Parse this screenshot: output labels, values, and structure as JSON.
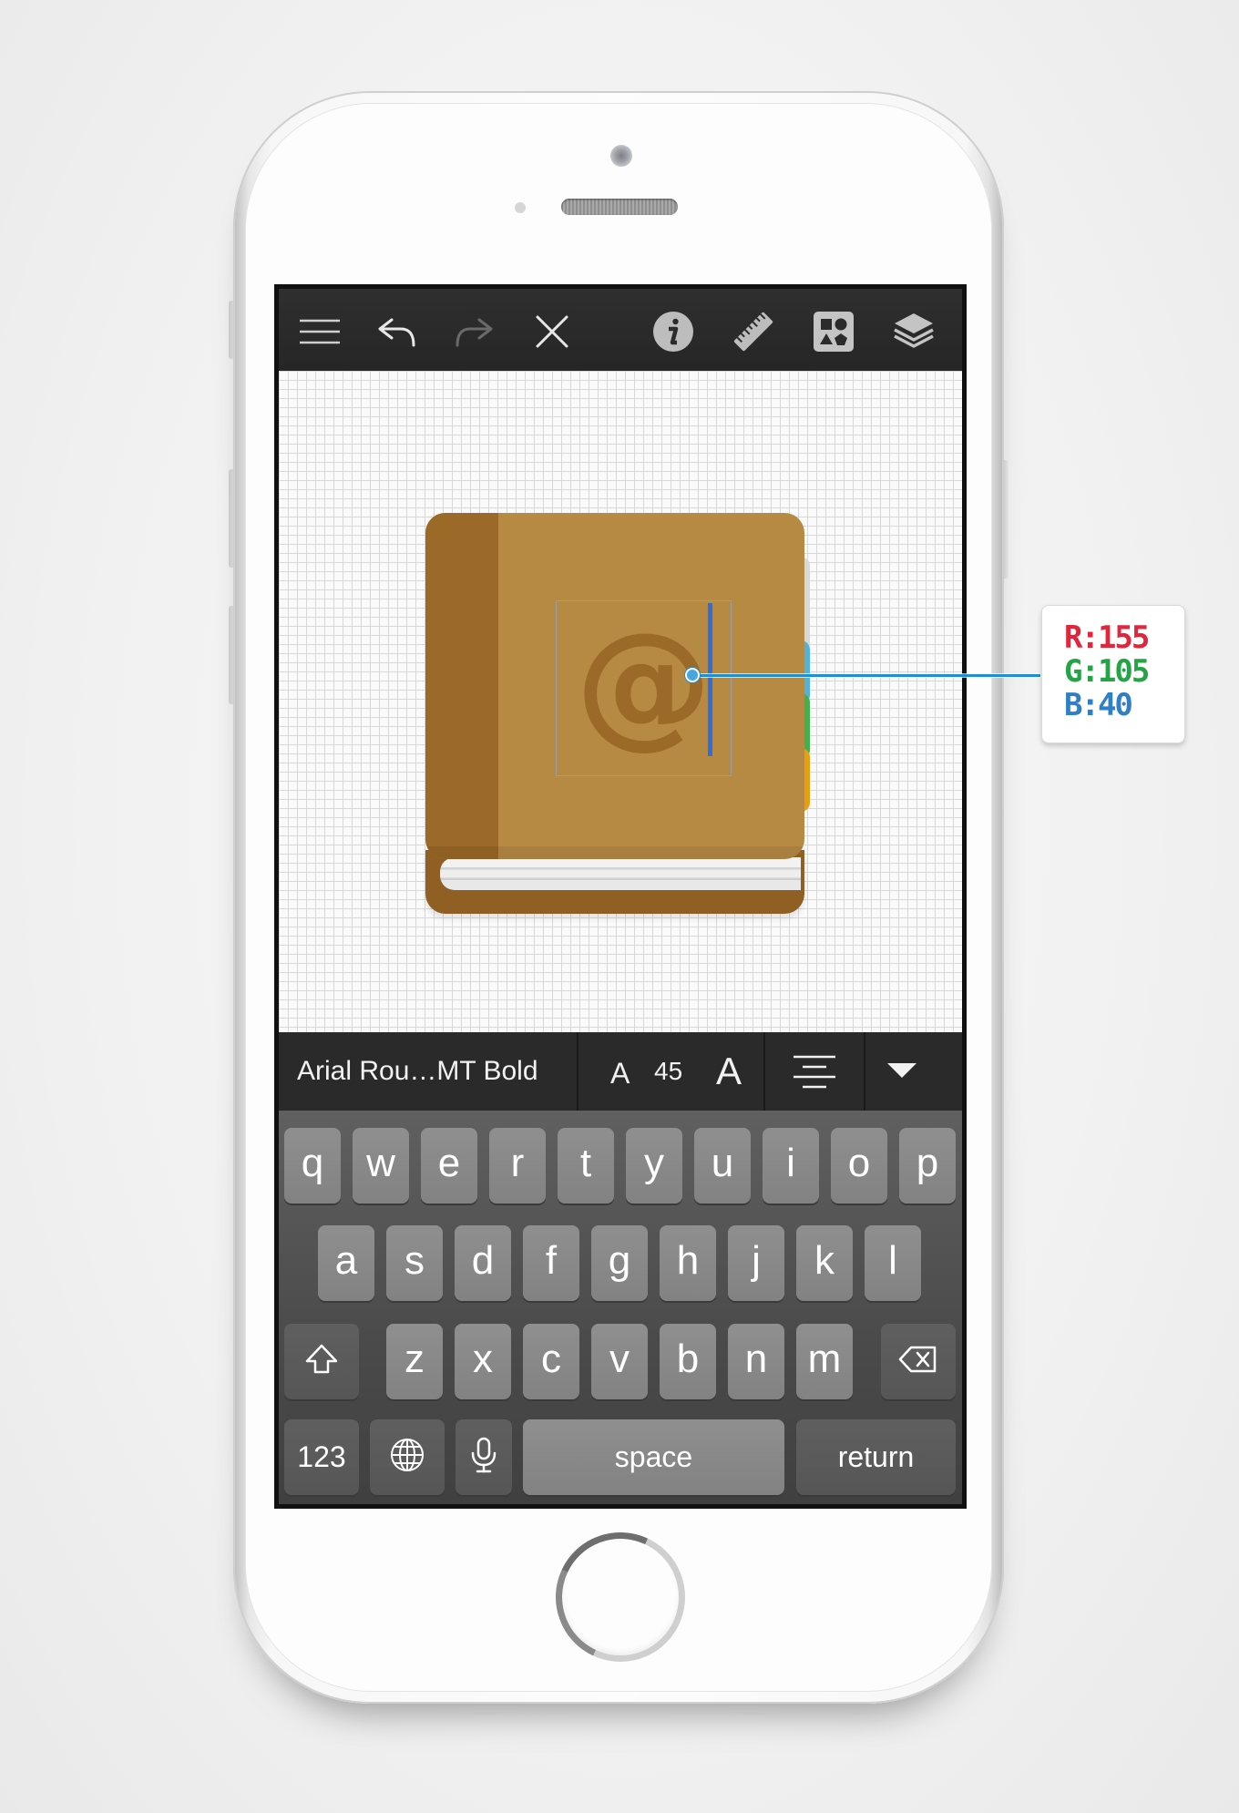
{
  "toolbar": {
    "icons": [
      "menu-icon",
      "undo-icon",
      "redo-icon",
      "close-icon",
      "info-icon",
      "ruler-icon",
      "shapes-icon",
      "layers-icon"
    ]
  },
  "canvas": {
    "selected_glyph": "@",
    "book_colors": {
      "cover": "#b78a44",
      "spine": "#9b6928",
      "tabs": [
        "#d9d9d9",
        "#4fb3dd",
        "#3fb14f",
        "#e5a011"
      ]
    }
  },
  "color_readout": {
    "r": "R:155",
    "g": "G:105",
    "b": "B:40",
    "colors": {
      "r": "#e0253d",
      "g": "#25a447",
      "b": "#2f7fc4"
    }
  },
  "format_bar": {
    "font_name": "Arial Rou…MT Bold",
    "decrease_label": "A",
    "font_size": "45",
    "increase_label": "A"
  },
  "keyboard": {
    "row1": [
      "q",
      "w",
      "e",
      "r",
      "t",
      "y",
      "u",
      "i",
      "o",
      "p"
    ],
    "row2": [
      "a",
      "s",
      "d",
      "f",
      "g",
      "h",
      "j",
      "k",
      "l"
    ],
    "row3": [
      "z",
      "x",
      "c",
      "v",
      "b",
      "n",
      "m"
    ],
    "numbers_label": "123",
    "space_label": "space",
    "return_label": "return"
  }
}
